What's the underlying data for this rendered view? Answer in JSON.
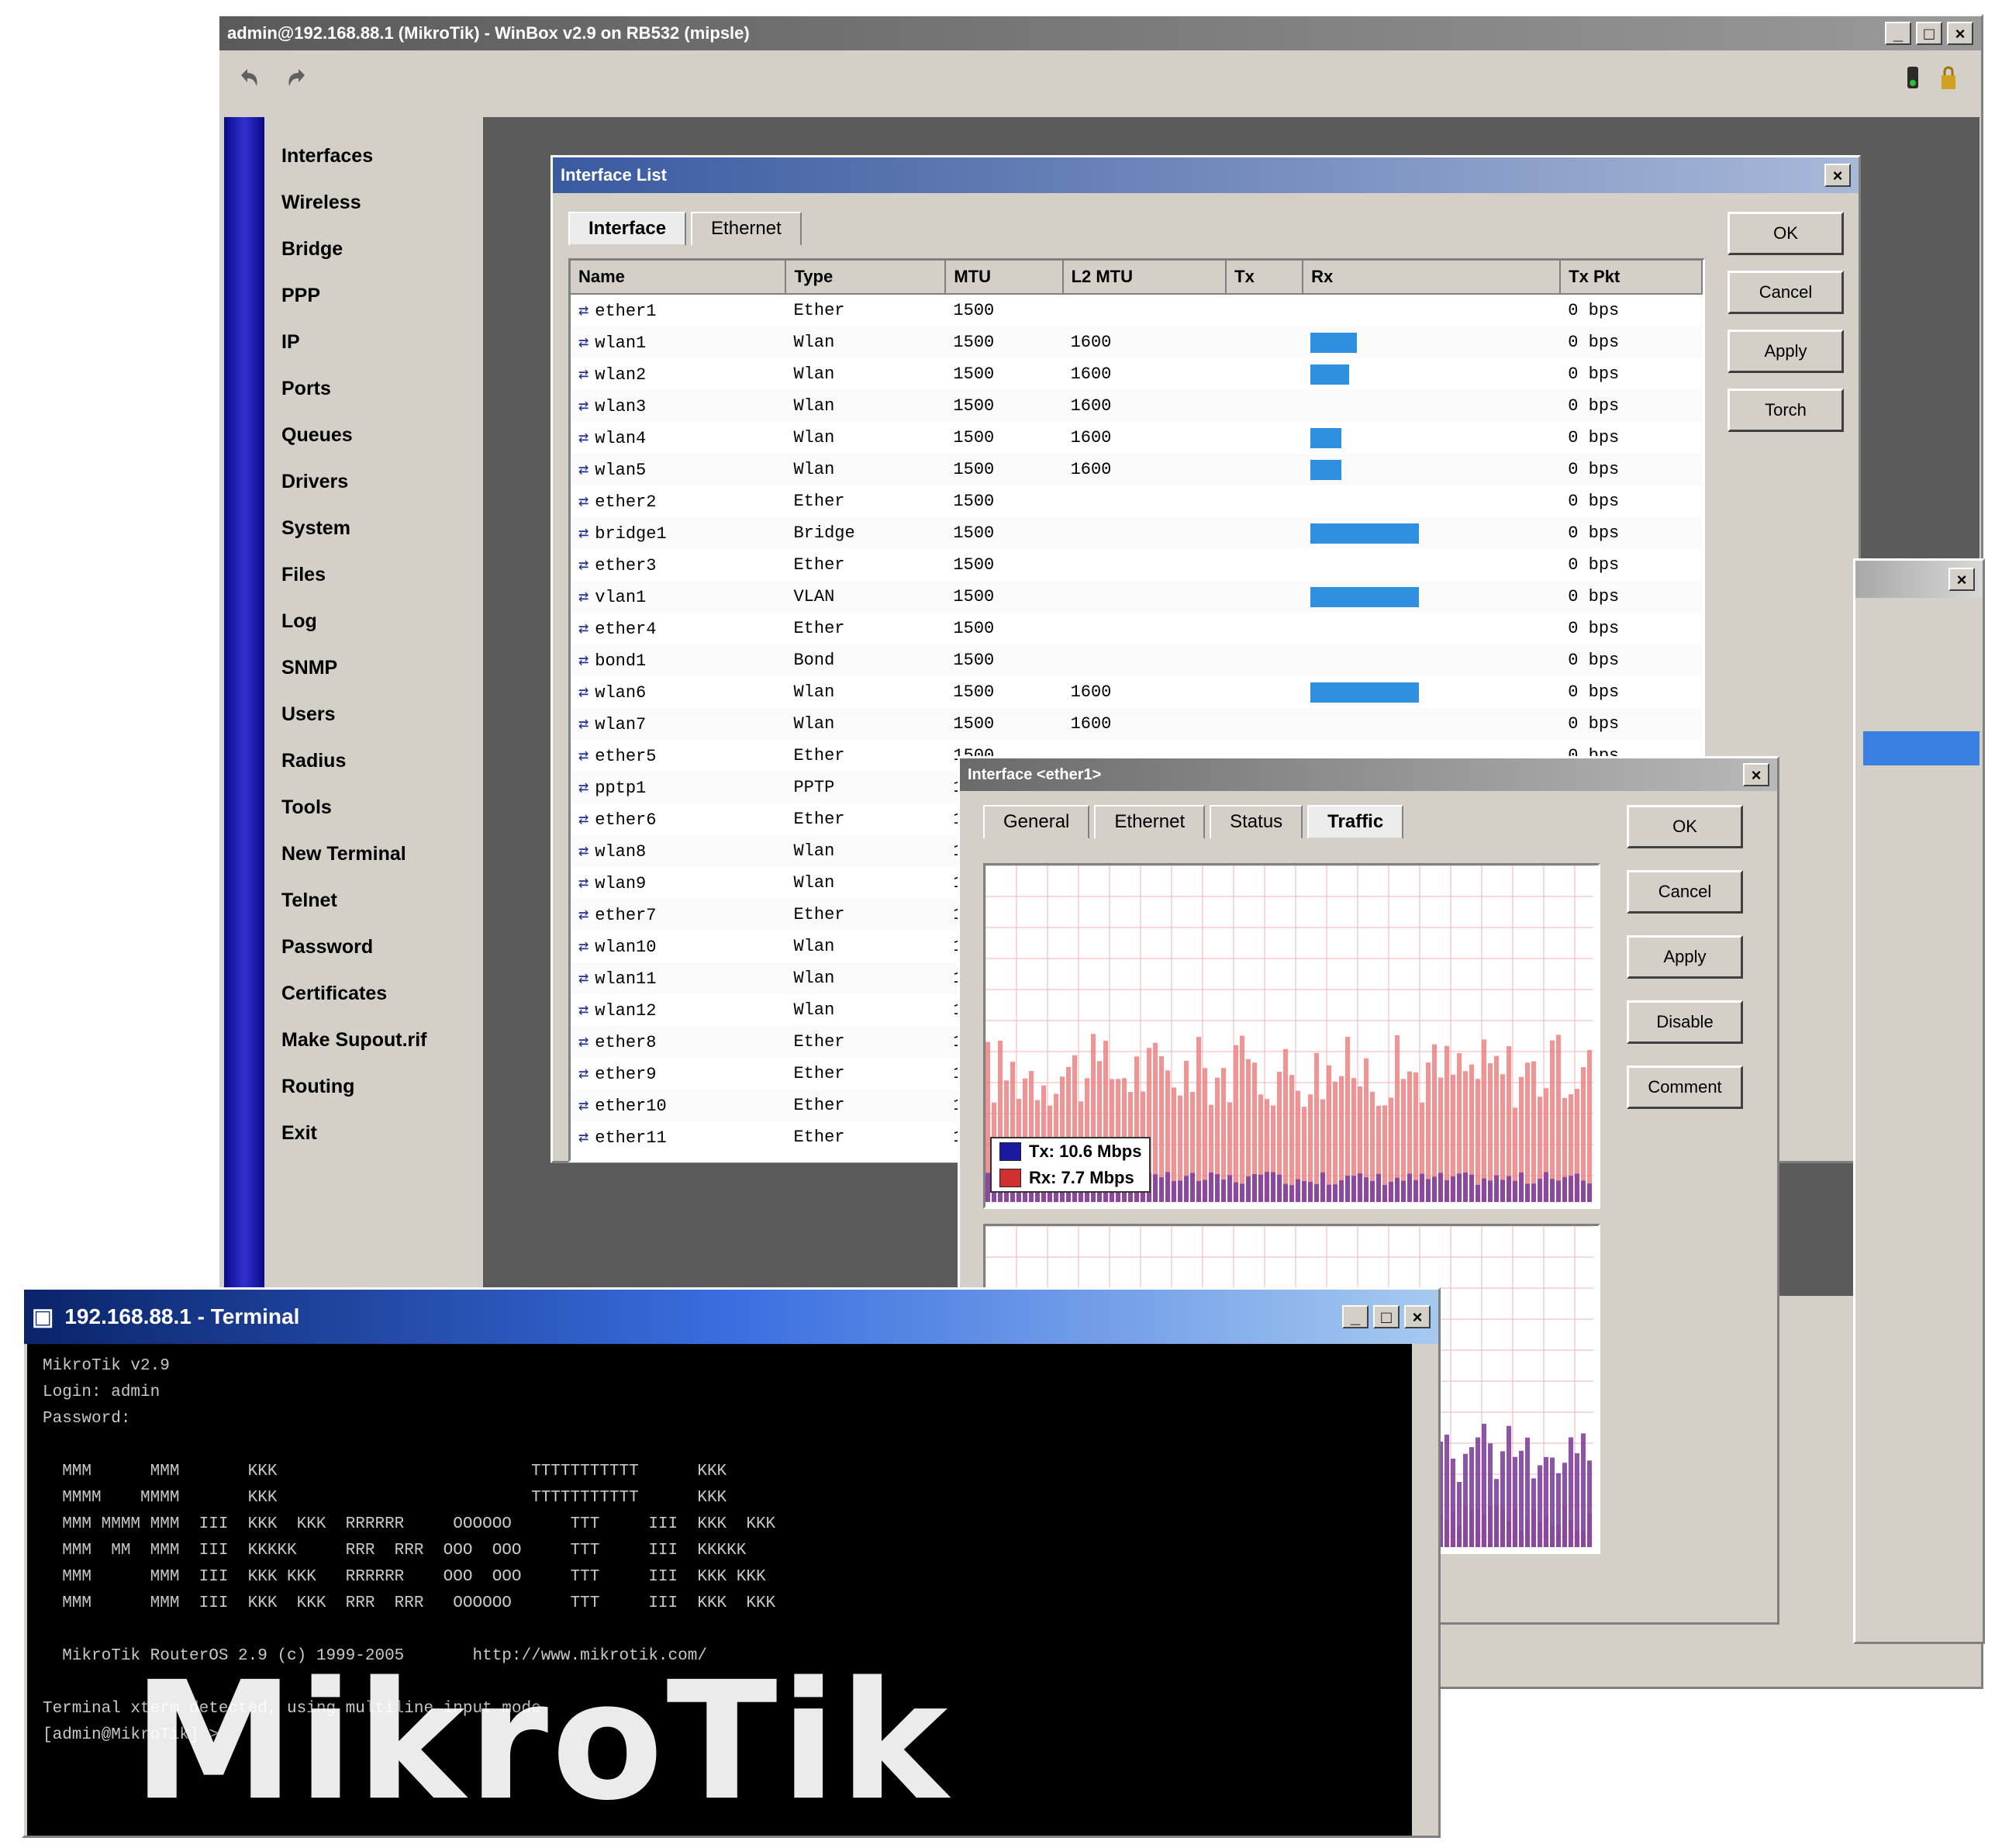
{
  "main": {
    "title": "admin@192.168.88.1 (MikroTik) - WinBox v2.9 on RB532 (mipsle)",
    "toolbar": {
      "undo_icon": "undo-icon",
      "redo_icon": "redo-icon"
    },
    "menu": [
      {
        "label": "Interfaces",
        "submenu": false
      },
      {
        "label": "Wireless",
        "submenu": false
      },
      {
        "label": "Bridge",
        "submenu": false
      },
      {
        "label": "PPP",
        "submenu": false
      },
      {
        "label": "IP",
        "submenu": true
      },
      {
        "label": "Ports",
        "submenu": false
      },
      {
        "label": "Queues",
        "submenu": false
      },
      {
        "label": "Drivers",
        "submenu": false
      },
      {
        "label": "System",
        "submenu": true
      },
      {
        "label": "Files",
        "submenu": false
      },
      {
        "label": "Log",
        "submenu": false
      },
      {
        "label": "SNMP",
        "submenu": false
      },
      {
        "label": "Users",
        "submenu": false
      },
      {
        "label": "Radius",
        "submenu": false
      },
      {
        "label": "Tools",
        "submenu": true
      },
      {
        "label": "New Terminal",
        "submenu": false
      },
      {
        "label": "Telnet",
        "submenu": false
      },
      {
        "label": "Password",
        "submenu": false
      },
      {
        "label": "Certificates",
        "submenu": false
      },
      {
        "label": "Make Supout.rif",
        "submenu": false
      },
      {
        "label": "Routing",
        "submenu": true
      },
      {
        "label": "Exit",
        "submenu": false
      }
    ]
  },
  "iface": {
    "title": "Interface List",
    "tabs": [
      "Interface",
      "Ethernet"
    ],
    "columns": [
      "Name",
      "Type",
      "MTU",
      "L2 MTU",
      "Tx",
      "Rx",
      "Tx Pkt"
    ],
    "rows": [
      {
        "name": "ether1",
        "type": "Ether",
        "mtu": "1500",
        "l2": "",
        "tx": "",
        "bar": 0,
        "rx": "0 bps"
      },
      {
        "name": "wlan1",
        "type": "Wlan",
        "mtu": "1500",
        "l2": "1600",
        "tx": "",
        "bar": 60,
        "rx": "0 bps"
      },
      {
        "name": "wlan2",
        "type": "Wlan",
        "mtu": "1500",
        "l2": "1600",
        "tx": "",
        "bar": 50,
        "rx": "0 bps"
      },
      {
        "name": "wlan3",
        "type": "Wlan",
        "mtu": "1500",
        "l2": "1600",
        "tx": "",
        "bar": 0,
        "rx": "0 bps"
      },
      {
        "name": "wlan4",
        "type": "Wlan",
        "mtu": "1500",
        "l2": "1600",
        "tx": "",
        "bar": 40,
        "rx": "0 bps"
      },
      {
        "name": "wlan5",
        "type": "Wlan",
        "mtu": "1500",
        "l2": "1600",
        "tx": "",
        "bar": 40,
        "rx": "0 bps"
      },
      {
        "name": "ether2",
        "type": "Ether",
        "mtu": "1500",
        "l2": "",
        "tx": "",
        "bar": 0,
        "rx": "0 bps"
      },
      {
        "name": "bridge1",
        "type": "Bridge",
        "mtu": "1500",
        "l2": "",
        "tx": "",
        "bar": 140,
        "rx": "0 bps"
      },
      {
        "name": "ether3",
        "type": "Ether",
        "mtu": "1500",
        "l2": "",
        "tx": "",
        "bar": 0,
        "rx": "0 bps"
      },
      {
        "name": "vlan1",
        "type": "VLAN",
        "mtu": "1500",
        "l2": "",
        "tx": "",
        "bar": 140,
        "rx": "0 bps"
      },
      {
        "name": "ether4",
        "type": "Ether",
        "mtu": "1500",
        "l2": "",
        "tx": "",
        "bar": 0,
        "rx": "0 bps"
      },
      {
        "name": "bond1",
        "type": "Bond",
        "mtu": "1500",
        "l2": "",
        "tx": "",
        "bar": 0,
        "rx": "0 bps"
      },
      {
        "name": "wlan6",
        "type": "Wlan",
        "mtu": "1500",
        "l2": "1600",
        "tx": "",
        "bar": 140,
        "rx": "0 bps"
      },
      {
        "name": "wlan7",
        "type": "Wlan",
        "mtu": "1500",
        "l2": "1600",
        "tx": "",
        "bar": 0,
        "rx": "0 bps"
      },
      {
        "name": "ether5",
        "type": "Ether",
        "mtu": "1500",
        "l2": "",
        "tx": "",
        "bar": 0,
        "rx": "0 bps"
      },
      {
        "name": "pptp1",
        "type": "PPTP",
        "mtu": "1460",
        "l2": "",
        "tx": "",
        "bar": 0,
        "rx": ""
      },
      {
        "name": "ether6",
        "type": "Ether",
        "mtu": "1500",
        "l2": "",
        "tx": "",
        "bar": 0,
        "rx": ""
      },
      {
        "name": "wlan8",
        "type": "Wlan",
        "mtu": "1500",
        "l2": "",
        "tx": "",
        "bar": 0,
        "rx": ""
      },
      {
        "name": "wlan9",
        "type": "Wlan",
        "mtu": "1500",
        "l2": "",
        "tx": "",
        "bar": 0,
        "rx": ""
      },
      {
        "name": "ether7",
        "type": "Ether",
        "mtu": "1500",
        "l2": "",
        "tx": "",
        "bar": 0,
        "rx": ""
      },
      {
        "name": "wlan10",
        "type": "Wlan",
        "mtu": "1500",
        "l2": "",
        "tx": "",
        "bar": 0,
        "rx": ""
      },
      {
        "name": "wlan11",
        "type": "Wlan",
        "mtu": "1500",
        "l2": "",
        "tx": "",
        "bar": 0,
        "rx": ""
      },
      {
        "name": "wlan12",
        "type": "Wlan",
        "mtu": "1500",
        "l2": "",
        "tx": "",
        "bar": 0,
        "rx": ""
      },
      {
        "name": "ether8",
        "type": "Ether",
        "mtu": "1500",
        "l2": "",
        "tx": "",
        "bar": 0,
        "rx": ""
      },
      {
        "name": "ether9",
        "type": "Ether",
        "mtu": "1500",
        "l2": "",
        "tx": "",
        "bar": 0,
        "rx": ""
      },
      {
        "name": "ether10",
        "type": "Ether",
        "mtu": "1500",
        "l2": "",
        "tx": "",
        "bar": 0,
        "rx": ""
      },
      {
        "name": "ether11",
        "type": "Ether",
        "mtu": "1500",
        "l2": "",
        "tx": "",
        "bar": 0,
        "rx": ""
      }
    ],
    "buttons": [
      "OK",
      "Cancel",
      "Apply",
      "Torch"
    ]
  },
  "graph": {
    "title": "Interface <ether1>",
    "tabs": [
      "General",
      "Ethernet",
      "Status",
      "Traffic"
    ],
    "legend": [
      {
        "label": "Tx: 10.6 Mbps",
        "color": "#1a1aa0"
      },
      {
        "label": "Rx: 7.7 Mbps",
        "color": "#d03030"
      }
    ],
    "buttons": [
      "OK",
      "Cancel",
      "Apply",
      "Disable",
      "Comment"
    ],
    "colors": {
      "tx_fill": "#8040a0",
      "rx_fill": "#f08080",
      "grid": "#f0b0b0"
    }
  },
  "terminal": {
    "title": "192.168.88.1 - Terminal",
    "lines": [
      "MikroTik v2.9",
      "Login: admin",
      "Password:",
      "",
      "  MMM      MMM       KKK                          TTTTTTTTTTT      KKK",
      "  MMMM    MMMM       KKK                          TTTTTTTTTTT      KKK",
      "  MMM MMMM MMM  III  KKK  KKK  RRRRRR     OOOOOO      TTT     III  KKK  KKK",
      "  MMM  MM  MMM  III  KKKKK     RRR  RRR  OOO  OOO     TTT     III  KKKKK",
      "  MMM      MMM  III  KKK KKK   RRRRRR    OOO  OOO     TTT     III  KKK KKK",
      "  MMM      MMM  III  KKK  KKK  RRR  RRR   OOOOOO      TTT     III  KKK  KKK",
      "",
      "  MikroTik RouterOS 2.9 (c) 1999-2005       http://www.mikrotik.com/",
      "",
      "Terminal xterm detected, using multiline input mode",
      "[admin@MikroTik] >"
    ],
    "logo": "MikroTik"
  }
}
